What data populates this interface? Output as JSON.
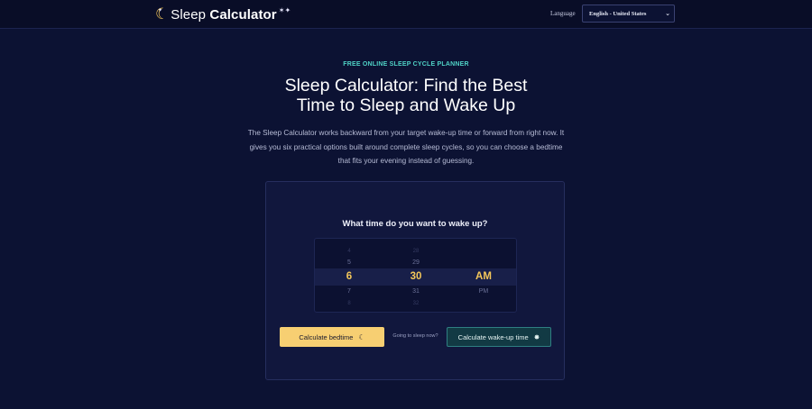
{
  "header": {
    "logo_regular": "Sleep ",
    "logo_bold": "Calculator",
    "language_label": "Language",
    "language_value": "English - United States"
  },
  "hero": {
    "eyebrow": "FREE ONLINE SLEEP CYCLE PLANNER",
    "title_line1": "Sleep Calculator: Find the Best",
    "title_line2": "Time to Sleep and Wake Up",
    "description": "The Sleep Calculator works backward from your target wake-up time or forward from right now. It gives you six practical options built around complete sleep cycles, so you can choose a bedtime that fits your evening instead of guessing."
  },
  "calculator": {
    "question": "What time do you want to wake up?",
    "hours": [
      "4",
      "5",
      "6",
      "7",
      "8"
    ],
    "minutes": [
      "28",
      "29",
      "30",
      "31",
      "32"
    ],
    "periods": [
      "AM",
      "PM"
    ],
    "selected": {
      "hour": "6",
      "minute": "30",
      "period": "AM"
    },
    "bedtime_button": "Calculate bedtime",
    "going_to_sleep": "Going to sleep now?",
    "wakeup_button": "Calculate wake-up time"
  }
}
